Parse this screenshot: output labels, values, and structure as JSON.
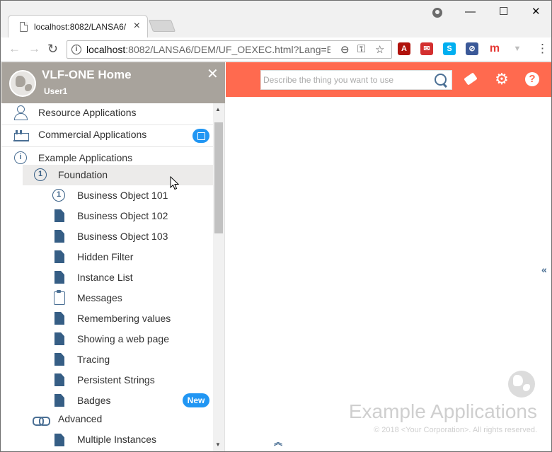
{
  "browser": {
    "tab_title": "localhost:8082/LANSA6/",
    "tab_close": "×",
    "window_controls": {
      "minimize": "—",
      "maximize": "☐",
      "close": "✕"
    },
    "nav": {
      "back": "←",
      "forward": "→",
      "reload": "↻"
    },
    "url_host": "localhost",
    "url_rest": ":8082/LANSA6/DEM/UF_OEXEC.html?Lang=E...",
    "info_icon": "i",
    "omnibox_icons": {
      "zoom": "⊖",
      "key": "⚿",
      "star": "☆"
    },
    "extensions": [
      {
        "name": "pdf-extension-icon",
        "glyph": "A",
        "color": "#b0120c"
      },
      {
        "name": "mail-extension-icon",
        "glyph": "✉",
        "color": "#d32f2f"
      },
      {
        "name": "skype-icon",
        "glyph": "S",
        "color": "#00aff0"
      },
      {
        "name": "blocker-extension-icon",
        "glyph": "⊘",
        "color": "#3b5998"
      },
      {
        "name": "m-extension-icon",
        "glyph": "m",
        "color": "#e53935"
      },
      {
        "name": "filter-extension-icon",
        "glyph": "▼",
        "color": "#bdbdbd"
      }
    ],
    "menu_glyph": "⋮"
  },
  "sidebar": {
    "title": "VLF-ONE Home",
    "user": "User1",
    "close_glyph": "✕",
    "top_items": [
      {
        "label": "Resource Applications",
        "icon": "user-icon"
      },
      {
        "label": "Commercial Applications",
        "icon": "factory-icon"
      },
      {
        "label": "Example Applications",
        "icon": "info-icon"
      }
    ],
    "foundation": {
      "label": "Foundation",
      "number": "1"
    },
    "children": [
      {
        "label": "Business Object 101",
        "icon": "number-one-icon"
      },
      {
        "label": "Business Object 102",
        "icon": "document-icon"
      },
      {
        "label": "Business Object 103",
        "icon": "document-icon"
      },
      {
        "label": "Hidden Filter",
        "icon": "document-icon"
      },
      {
        "label": "Instance List",
        "icon": "document-icon"
      },
      {
        "label": "Messages",
        "icon": "clipboard-icon"
      },
      {
        "label": "Remembering values",
        "icon": "document-icon"
      },
      {
        "label": "Showing a web page",
        "icon": "document-icon"
      },
      {
        "label": "Tracing",
        "icon": "document-icon"
      },
      {
        "label": "Persistent Strings",
        "icon": "document-icon"
      },
      {
        "label": "Badges",
        "icon": "document-icon"
      }
    ],
    "badge_new": "New",
    "advanced": {
      "label": "Advanced"
    },
    "multiple_instances": {
      "label": "Multiple Instances"
    },
    "info_glyph": "i",
    "scroll_up": "▲",
    "scroll_down": "▼"
  },
  "topbar": {
    "search_placeholder": "Describe the thing you want to use",
    "gear_glyph": "⚙",
    "help_glyph": "?",
    "color": "#ff6a4f"
  },
  "main": {
    "collapse_glyph": "«",
    "expand_up_glyph": "︽",
    "watermark_title": "Example Applications",
    "watermark_copyright": "© 2018 <Your Corporation>. All rights reserved."
  }
}
